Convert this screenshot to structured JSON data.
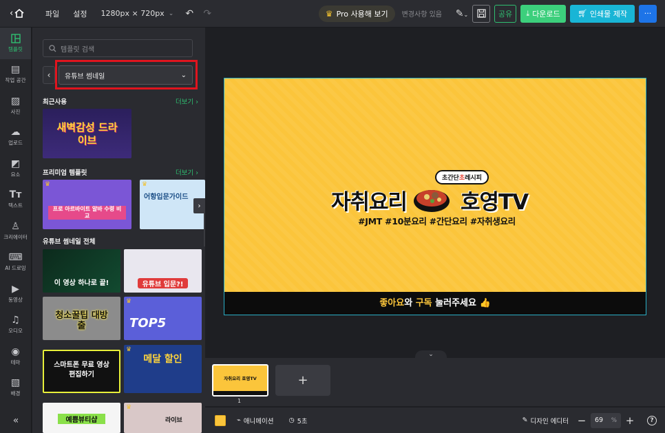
{
  "topbar": {
    "menu_file": "파일",
    "menu_settings": "설정",
    "canvas_size": "1280px × 720px",
    "pro_button": "Pro 사용해 보기",
    "status": "변경사항 있음",
    "share": "공유",
    "download": "다운로드",
    "print": "인쇄물 제작",
    "more": "···"
  },
  "rail": {
    "items": [
      {
        "label": "템플릿",
        "icon": "template-icon"
      },
      {
        "label": "작업 공간",
        "icon": "workspace-icon"
      },
      {
        "label": "사진",
        "icon": "photo-icon"
      },
      {
        "label": "업로드",
        "icon": "upload-icon"
      },
      {
        "label": "요소",
        "icon": "elements-icon"
      },
      {
        "label": "텍스트",
        "icon": "text-icon"
      },
      {
        "label": "크리에이터",
        "icon": "creator-icon"
      },
      {
        "label": "AI 드로잉",
        "icon": "ai-drawing-icon"
      },
      {
        "label": "동영상",
        "icon": "video-icon"
      },
      {
        "label": "오디오",
        "icon": "audio-icon"
      },
      {
        "label": "테마",
        "icon": "theme-icon"
      },
      {
        "label": "배경",
        "icon": "background-icon"
      }
    ]
  },
  "panel": {
    "search_placeholder": "템플릿 검색",
    "category": "유튜브 썸네일",
    "recent_title": "최근사용",
    "premium_title": "프리미엄 템플릿",
    "all_title": "유튜브 썸네일 전체",
    "more": "더보기",
    "recent": [
      {
        "title": "새벽감성 드라이브"
      }
    ],
    "premium": [
      {
        "title": "프로 아르바이트 알바 수령 비교"
      },
      {
        "title": "어항입문가이드"
      }
    ],
    "all": [
      {
        "title": "이 영상 하나로 끝!"
      },
      {
        "title": "유튜브 입문?!"
      },
      {
        "title": "청소꿀팁 대방출"
      },
      {
        "title": "TOP5"
      },
      {
        "title": "스마트폰 무료 영상편집하기"
      },
      {
        "title": "메달 할인"
      },
      {
        "title": "예쁨뷰티샵"
      },
      {
        "title": "라이브"
      }
    ]
  },
  "artboard": {
    "title_left": "자취요리",
    "title_right": "호영TV",
    "bubble_a": "초간단",
    "bubble_b": "초",
    "bubble_c": "레시피",
    "hashtags": "#JMT #10분요리 #간단요리 #자취생요리",
    "footer_a": "좋아요",
    "footer_b": "와 ",
    "footer_c": "구독",
    "footer_d": " 눌러주세요 👍",
    "background": "#fbc53b"
  },
  "pages": {
    "current": "1",
    "thumb_text": "자취요리 호영TV"
  },
  "bottombar": {
    "animation": "애니메이션",
    "duration": "5초",
    "design_editor": "디자인 에디터",
    "zoom_value": "69",
    "zoom_unit": "%"
  }
}
